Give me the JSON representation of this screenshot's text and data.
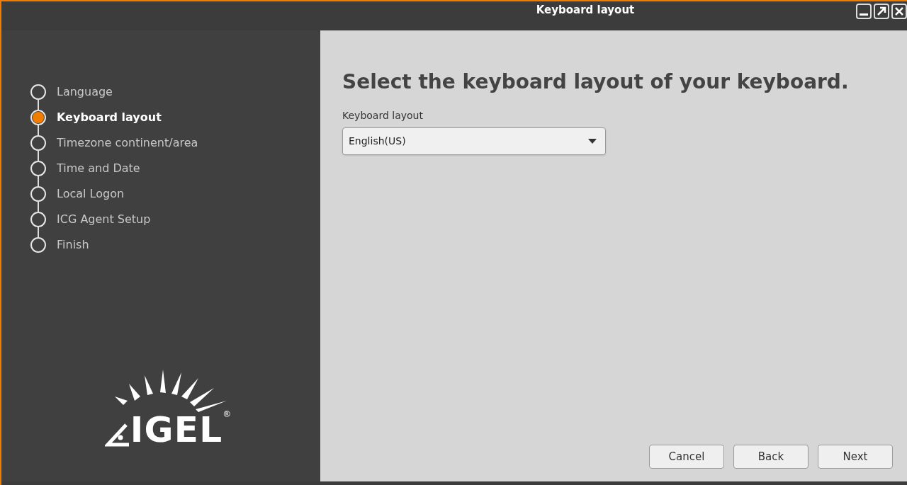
{
  "window": {
    "title": "Keyboard layout"
  },
  "steps": [
    {
      "label": "Language",
      "selected": false
    },
    {
      "label": "Keyboard layout",
      "selected": true
    },
    {
      "label": "Timezone continent/area",
      "selected": false
    },
    {
      "label": "Time and Date",
      "selected": false
    },
    {
      "label": "Local Logon",
      "selected": false
    },
    {
      "label": "ICG Agent Setup",
      "selected": false
    },
    {
      "label": "Finish",
      "selected": false
    }
  ],
  "logo": {
    "text": "IGEL",
    "mark": "®"
  },
  "heading": "Select the keyboard layout of your keyboard.",
  "field": {
    "label": "Keyboard layout",
    "value": "English(US)"
  },
  "buttons": [
    "Cancel",
    "Back",
    "Next"
  ]
}
